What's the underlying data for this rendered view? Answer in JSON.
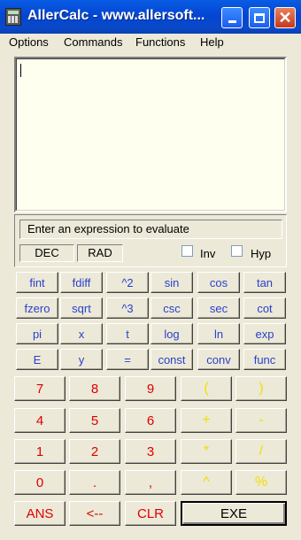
{
  "window": {
    "title": "AllerCalc - www.allersoft...",
    "minimize_icon": "minimize-icon",
    "maximize_icon": "maximize-icon",
    "close_icon": "close-icon",
    "close_glyph": "✕"
  },
  "menu": {
    "items": [
      "Options",
      "Commands",
      "Functions",
      "Help"
    ]
  },
  "display": {
    "value": ""
  },
  "status": {
    "message": "Enter an expression to evaluate",
    "number_mode": "DEC",
    "angle_mode": "RAD",
    "inv_label": "Inv",
    "inv_checked": false,
    "hyp_label": "Hyp",
    "hyp_checked": false
  },
  "function_keys": [
    [
      "fint",
      "fdiff",
      "^2",
      "sin",
      "cos",
      "tan"
    ],
    [
      "fzero",
      "sqrt",
      "^3",
      "csc",
      "sec",
      "cot"
    ],
    [
      "pi",
      "x",
      "t",
      "log",
      "ln",
      "exp"
    ],
    [
      "E",
      "y",
      "=",
      "const",
      "conv",
      "func"
    ]
  ],
  "number_keys": [
    [
      "7",
      "8",
      "9",
      "(",
      ")"
    ],
    [
      "4",
      "5",
      "6",
      "+",
      "-"
    ],
    [
      "1",
      "2",
      "3",
      "*",
      "/"
    ],
    [
      "0",
      ".",
      ",",
      "^",
      "%"
    ]
  ],
  "bottom_keys": {
    "ans": "ANS",
    "backspace": "<--",
    "clear": "CLR",
    "exe": "EXE"
  },
  "colors": {
    "function_text": "#2a3fcc",
    "number_text": "#e00000",
    "operator_text": "#f0e000",
    "display_bg": "#fffff0"
  }
}
